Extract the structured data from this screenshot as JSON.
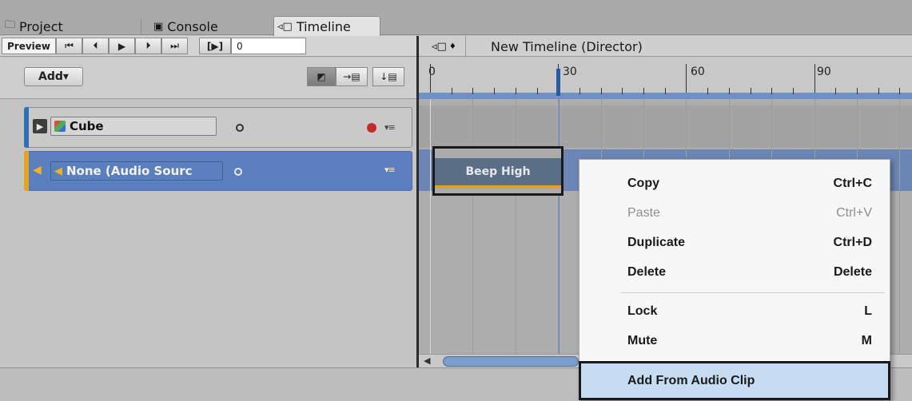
{
  "tabs": [
    {
      "label": "Project",
      "icon": "folder-icon"
    },
    {
      "label": "Console",
      "icon": "console-icon"
    },
    {
      "label": "Timeline",
      "icon": "timeline-icon",
      "active": true
    }
  ],
  "toolbar": {
    "preview_label": "Preview",
    "play_range_label": "[▶]",
    "frame_value": "0",
    "add_label": "Add▾"
  },
  "timeline_header": {
    "title": "New Timeline (Director)"
  },
  "ruler": {
    "labels": [
      "0",
      "30",
      "60",
      "90"
    ]
  },
  "tracks": [
    {
      "name": "Cube",
      "type": "animation",
      "color": "#2f6fb5"
    },
    {
      "name": "None (Audio Sourc",
      "type": "audio",
      "color": "#e8a21c"
    }
  ],
  "clip": {
    "name": "Beep High"
  },
  "context_menu": {
    "items": [
      {
        "label": "Copy",
        "shortcut": "Ctrl+C",
        "enabled": true
      },
      {
        "label": "Paste",
        "shortcut": "Ctrl+V",
        "enabled": false
      },
      {
        "label": "Duplicate",
        "shortcut": "Ctrl+D",
        "enabled": true
      },
      {
        "label": "Delete",
        "shortcut": "Delete",
        "enabled": true
      },
      {
        "label": "Lock",
        "shortcut": "L",
        "enabled": true
      },
      {
        "label": "Mute",
        "shortcut": "M",
        "enabled": true
      },
      {
        "label": "Add From  Audio Clip",
        "shortcut": "",
        "enabled": true,
        "highlighted": true
      }
    ]
  }
}
